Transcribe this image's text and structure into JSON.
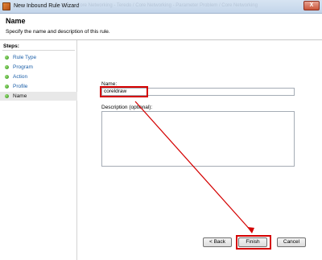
{
  "window": {
    "title": "New Inbound Rule Wizard",
    "ghost_text": "Core Networking - Teredo / Core Networking - Parameter Problem / Core Networking",
    "close_glyph": "X"
  },
  "header": {
    "title": "Name",
    "description": "Specify the name and description of this rule."
  },
  "steps": {
    "title": "Steps:",
    "items": [
      {
        "label": "Rule Type"
      },
      {
        "label": "Program"
      },
      {
        "label": "Action"
      },
      {
        "label": "Profile"
      },
      {
        "label": "Name"
      }
    ]
  },
  "form": {
    "name_label": "Name:",
    "name_value": "coreldraw",
    "description_label": "Description (optional):",
    "description_value": ""
  },
  "buttons": {
    "back": "< Back",
    "finish": "Finish",
    "cancel": "Cancel"
  },
  "annotation_color": "#d40000"
}
